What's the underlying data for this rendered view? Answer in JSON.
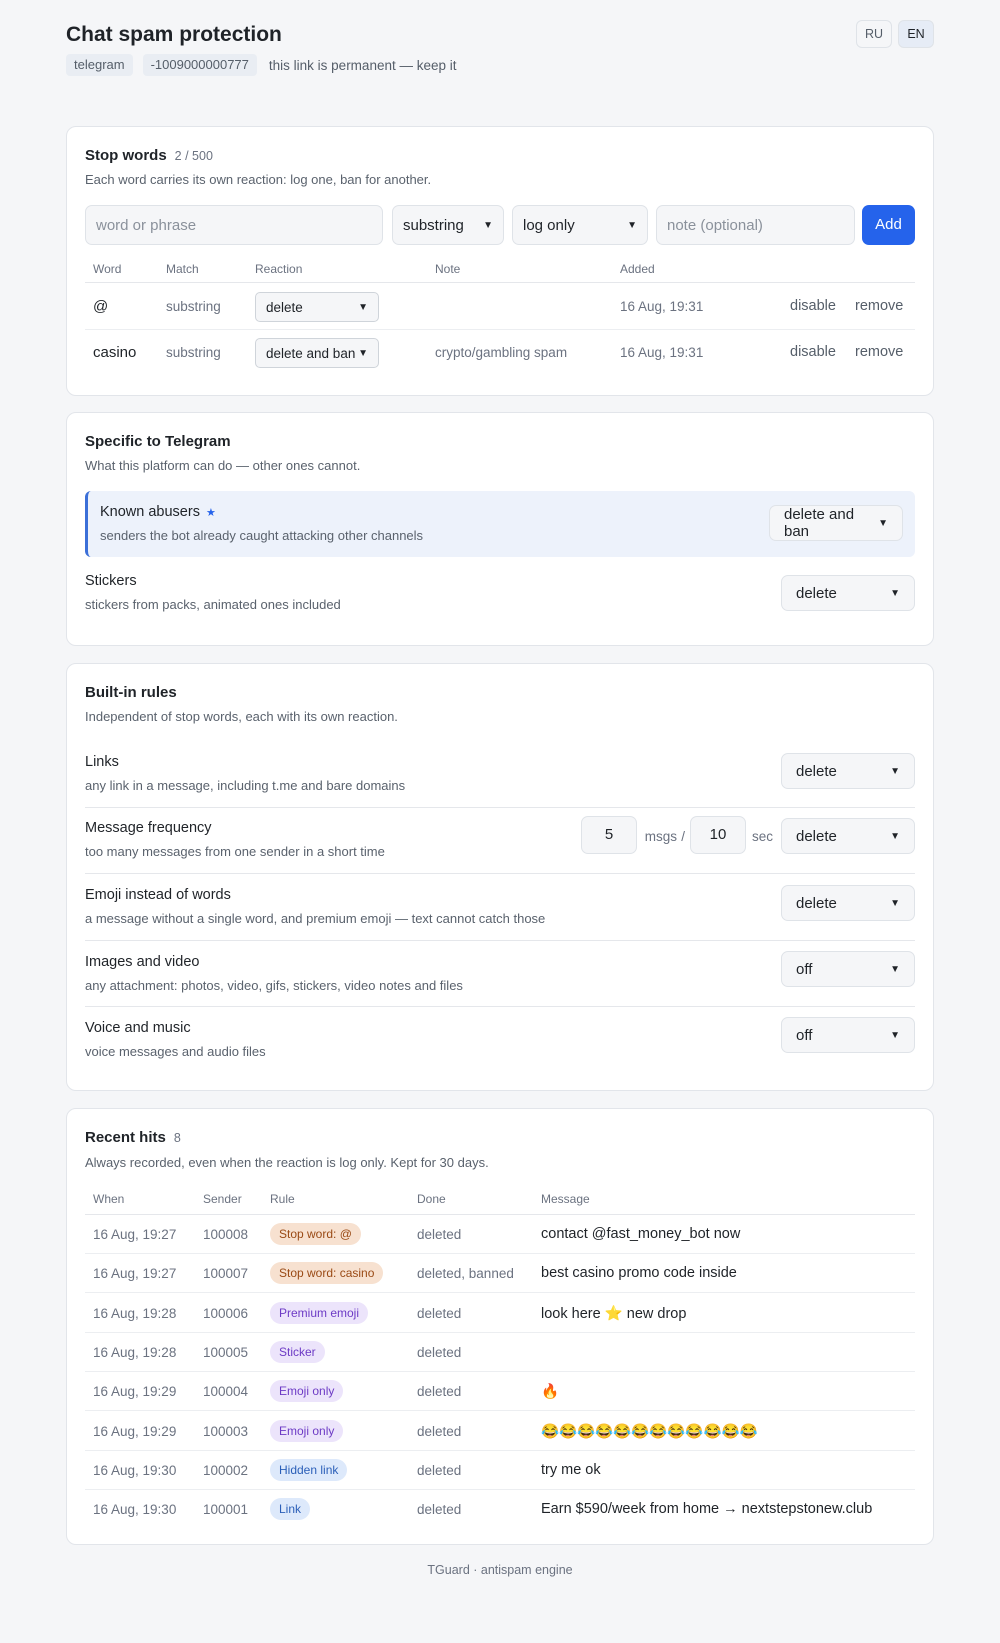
{
  "header": {
    "title": "Chat spam protection",
    "platform_tag": "telegram",
    "chat_id": "-1009000000777",
    "link_note": "this link is permanent — keep it",
    "langs": [
      "RU",
      "EN"
    ],
    "active_lang": "EN"
  },
  "stop_words": {
    "title": "Stop words",
    "count": "2 / 500",
    "subtitle": "Each word carries its own reaction: log one, ban for another.",
    "form": {
      "word_placeholder": "word or phrase",
      "match_value": "substring",
      "reaction_value": "log only",
      "note_placeholder": "note (optional)",
      "add_label": "Add"
    },
    "columns": [
      "Word",
      "Match",
      "Reaction",
      "Note",
      "Added"
    ],
    "rows": [
      {
        "word": "@",
        "match": "substring",
        "reaction": "delete",
        "note": "",
        "added": "16 Aug, 19:31",
        "disable": "disable",
        "remove": "remove"
      },
      {
        "word": "casino",
        "match": "substring",
        "reaction": "delete and ban",
        "note": "crypto/gambling spam",
        "added": "16 Aug, 19:31",
        "disable": "disable",
        "remove": "remove"
      }
    ]
  },
  "telegram": {
    "title": "Specific to Telegram",
    "subtitle": "What this platform can do — other ones cannot.",
    "items": [
      {
        "title": "Known abusers",
        "star": "★",
        "desc": "senders the bot already caught attacking other channels",
        "reaction": "delete and ban"
      },
      {
        "title": "Stickers",
        "desc": "stickers from packs, animated ones included",
        "reaction": "delete"
      }
    ]
  },
  "rules": {
    "title": "Built-in rules",
    "subtitle": "Independent of stop words, each with its own reaction.",
    "items": [
      {
        "title": "Links",
        "desc": "any link in a message, including t.me and bare domains",
        "reaction": "delete"
      },
      {
        "title": "Message frequency",
        "desc": "too many messages from one sender in a short time",
        "reaction": "delete",
        "msgs": "5",
        "msgs_unit": "msgs",
        "sep": "/",
        "secs": "10",
        "secs_unit": "sec"
      },
      {
        "title": "Emoji instead of words",
        "desc": "a message without a single word, and premium emoji — text cannot catch those",
        "reaction": "delete"
      },
      {
        "title": "Images and video",
        "desc": "any attachment: photos, video, gifs, stickers, video notes and files",
        "reaction": "off"
      },
      {
        "title": "Voice and music",
        "desc": "voice messages and audio files",
        "reaction": "off"
      }
    ]
  },
  "hits": {
    "title": "Recent hits",
    "count": "8",
    "subtitle": "Always recorded, even when the reaction is log only. Kept for 30 days.",
    "columns": [
      "When",
      "Sender",
      "Rule",
      "Done",
      "Message"
    ],
    "rows": [
      {
        "when": "16 Aug, 19:27",
        "sender": "100008",
        "rule": "Stop word: @",
        "rule_color": "orange",
        "done": "deleted",
        "message": "contact @fast_money_bot now"
      },
      {
        "when": "16 Aug, 19:27",
        "sender": "100007",
        "rule": "Stop word: casino",
        "rule_color": "orange",
        "done": "deleted, banned",
        "message": "best casino promo code inside"
      },
      {
        "when": "16 Aug, 19:28",
        "sender": "100006",
        "rule": "Premium emoji",
        "rule_color": "purple",
        "done": "deleted",
        "message": "look here ⭐ new drop"
      },
      {
        "when": "16 Aug, 19:28",
        "sender": "100005",
        "rule": "Sticker",
        "rule_color": "purple",
        "done": "deleted",
        "message": ""
      },
      {
        "when": "16 Aug, 19:29",
        "sender": "100004",
        "rule": "Emoji only",
        "rule_color": "purple",
        "done": "deleted",
        "message": "🔥"
      },
      {
        "when": "16 Aug, 19:29",
        "sender": "100003",
        "rule": "Emoji only",
        "rule_color": "purple",
        "done": "deleted",
        "message": "😂😂😂😂😂😂😂😂😂😂😂😂"
      },
      {
        "when": "16 Aug, 19:30",
        "sender": "100002",
        "rule": "Hidden link",
        "rule_color": "blue",
        "done": "deleted",
        "message": "try me ok"
      },
      {
        "when": "16 Aug, 19:30",
        "sender": "100001",
        "rule": "Link",
        "rule_color": "blue",
        "done": "deleted",
        "message": "Earn $590/week from home → nextstepstonew.club"
      }
    ]
  },
  "footer": "TGuard · antispam engine",
  "colors": {
    "accent": "#2563eb",
    "highlight_bg": "#edf2fb",
    "badge_orange": "#f7e1d0",
    "badge_purple": "#ece4fb",
    "badge_blue": "#dde9fb"
  }
}
